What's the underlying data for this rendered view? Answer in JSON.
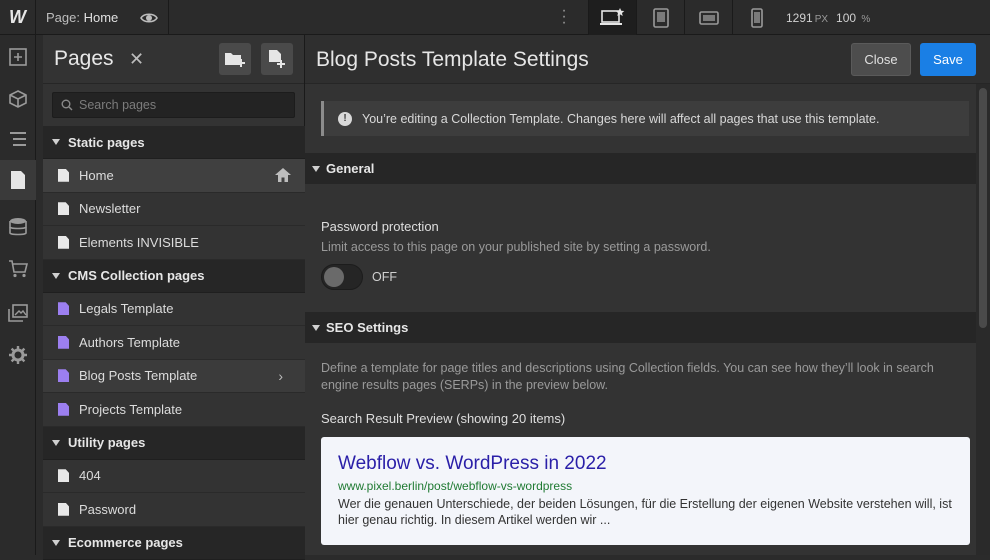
{
  "topbar": {
    "logo": "W",
    "page_prefix": "Page:",
    "page_name": "Home",
    "width_value": "1291",
    "width_unit": "PX",
    "zoom_value": "100",
    "zoom_unit": "%"
  },
  "pages_panel": {
    "title": "Pages",
    "close_glyph": "✕",
    "search_placeholder": "Search pages",
    "sections": [
      {
        "label": "Static pages",
        "items": [
          {
            "label": "Home",
            "kind": "static",
            "selected": true
          },
          {
            "label": "Newsletter",
            "kind": "static"
          },
          {
            "label": "Elements INVISIBLE",
            "kind": "static"
          }
        ]
      },
      {
        "label": "CMS Collection pages",
        "items": [
          {
            "label": "Legals Template",
            "kind": "cms"
          },
          {
            "label": "Authors Template",
            "kind": "cms"
          },
          {
            "label": "Blog Posts Template",
            "kind": "cms",
            "hover": true
          },
          {
            "label": "Projects Template",
            "kind": "cms"
          }
        ]
      },
      {
        "label": "Utility pages",
        "items": [
          {
            "label": "404",
            "kind": "static"
          },
          {
            "label": "Password",
            "kind": "static"
          }
        ]
      },
      {
        "label": "Ecommerce pages",
        "items": []
      }
    ]
  },
  "settings": {
    "title": "Blog Posts Template Settings",
    "close_label": "Close",
    "save_label": "Save",
    "notice": "You’re editing a Collection Template. Changes here will affect all pages that use this template.",
    "general": {
      "heading": "General",
      "password_label": "Password protection",
      "password_desc": "Limit access to this page on your published site by setting a password.",
      "toggle_state": "OFF"
    },
    "seo": {
      "heading": "SEO Settings",
      "desc": "Define a template for page titles and descriptions using Collection fields. You can see how they’ll look in search engine results pages (SERPs) in the preview below.",
      "preview_label": "Search Result Preview (showing 20 items)",
      "serp_title": "Webflow vs. WordPress in 2022",
      "serp_url": "www.pixel.berlin/post/webflow-vs-wordpress",
      "serp_desc": "Wer die genauen Unterschiede, der beiden Lösungen, für die Erstellung der eigenen Website verstehen will, ist hier genau richtig. In diesem Artikel werden wir ..."
    }
  },
  "colors": {
    "accent": "#1a7fe5",
    "cms_icon": "#9c7ff0",
    "serp_title": "#2a1fa8",
    "serp_url": "#1f7a32"
  }
}
